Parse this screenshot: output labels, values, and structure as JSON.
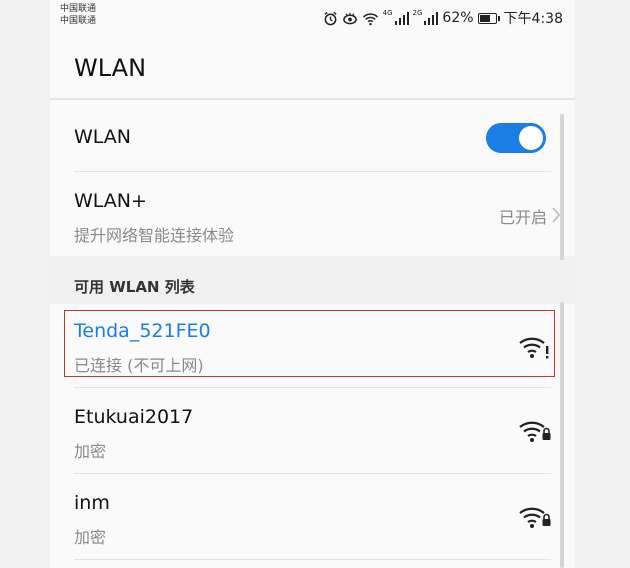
{
  "status_bar": {
    "carrier_1": "中国联通",
    "carrier_2": "中国联通",
    "net_1": "4G",
    "net_2": "2G",
    "battery_text": "62%",
    "battery_level": 0.62,
    "time": "下午4:38"
  },
  "header": {
    "title": "WLAN"
  },
  "wlan_toggle": {
    "label": "WLAN",
    "state": "on"
  },
  "wlan_plus": {
    "title": "WLAN+",
    "subtitle": "提升网络智能连接体验",
    "status": "已开启"
  },
  "section": {
    "title": "可用 WLAN 列表"
  },
  "networks": [
    {
      "ssid": "Tenda_521FE0",
      "status": "已连接 (不可上网)",
      "icon": "wifi-warning-icon"
    },
    {
      "ssid": "Etukuai2017",
      "status": "加密",
      "icon": "wifi-locked-icon"
    },
    {
      "ssid": "inm",
      "status": "加密",
      "icon": "wifi-locked-icon"
    }
  ],
  "colors": {
    "accent": "#1a7ee6",
    "highlight_border": "#c0392b"
  }
}
